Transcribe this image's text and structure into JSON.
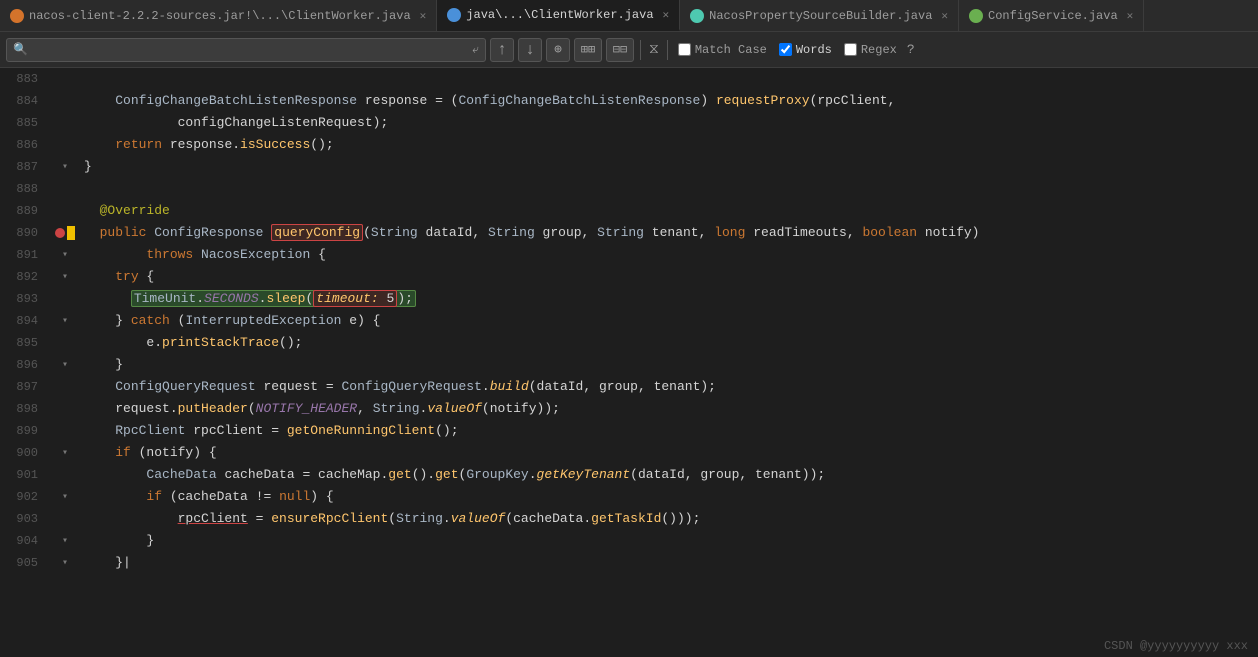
{
  "tabs": [
    {
      "id": "tab1",
      "icon": "orange",
      "label": "nacos-client-2.2.2-sources.jar!\\...\\ClientWorker.java",
      "active": false
    },
    {
      "id": "tab2",
      "icon": "blue",
      "label": "java\\...\\ClientWorker.java",
      "active": true
    },
    {
      "id": "tab3",
      "icon": "teal",
      "label": "NacosPropertySourceBuilder.java",
      "active": false
    },
    {
      "id": "tab4",
      "icon": "green",
      "label": "ConfigService.java",
      "active": false
    }
  ],
  "search": {
    "placeholder": "",
    "value": "",
    "match_case_label": "Match Case",
    "words_label": "Words",
    "regex_label": "Regex",
    "words_checked": true,
    "help_label": "?"
  },
  "lines": [
    {
      "num": 883,
      "icons": "",
      "code_html": ""
    },
    {
      "num": 884,
      "icons": "",
      "code_html": "    <span class='type'>ConfigChangeBatchListenResponse</span> response = (<span class='type'>ConfigChangeBatchListenResponse</span>) <span class='method'>requestProxy</span>(rpcClient,"
    },
    {
      "num": 885,
      "icons": "",
      "code_html": "            configChangeListenRequest);"
    },
    {
      "num": 886,
      "icons": "",
      "code_html": "    <span class='kw'>return</span> response.<span class='method'>isSuccess</span>();"
    },
    {
      "num": 887,
      "icons": "fold",
      "code_html": "}"
    },
    {
      "num": 888,
      "icons": "",
      "code_html": ""
    },
    {
      "num": 889,
      "icons": "",
      "code_html": "  <span class='annotation'>@Override</span>"
    },
    {
      "num": 890,
      "icons": "bp+debug",
      "code_html": "  <span class='kw'>public</span> <span class='type'>ConfigResponse</span> <span class='highlight-box'><span class='method'>queryConfig</span></span>(<span class='type'>String</span> dataId, <span class='type'>String</span> group, <span class='type'>String</span> tenant, <span class='kw'>long</span> readTimeouts, <span class='kw'>boolean</span> notify)"
    },
    {
      "num": 891,
      "icons": "fold",
      "code_html": "        <span class='kw'>throws</span> <span class='type'>NacosException</span> {"
    },
    {
      "num": 892,
      "icons": "fold",
      "code_html": "    <span class='kw'>try</span> {"
    },
    {
      "num": 893,
      "icons": "",
      "code_html": "      <span class='highlight-box2'><span class='type'>TimeUnit</span>.<span class='constant italic-param'>SECONDS</span>.<span class='method'>sleep</span>(<span class='highlight-box'><span class='italic-param param'>timeout:</span> 5</span>);</span>"
    },
    {
      "num": 894,
      "icons": "fold",
      "code_html": "    } <span class='kw'>catch</span> (<span class='type'>InterruptedException</span> e) {"
    },
    {
      "num": 895,
      "icons": "",
      "code_html": "        e.<span class='method'>printStackTrace</span>();"
    },
    {
      "num": 896,
      "icons": "fold",
      "code_html": "    }"
    },
    {
      "num": 897,
      "icons": "",
      "code_html": "    <span class='type'>ConfigQueryRequest</span> request = <span class='type'>ConfigQueryRequest</span>.<span class='method italic-param'>build</span>(dataId, group, tenant);"
    },
    {
      "num": 898,
      "icons": "",
      "code_html": "    request.<span class='method'>putHeader</span>(<span class='constant italic-param'>NOTIFY_HEADER</span>, <span class='type'>String</span>.<span class='method italic-param'>valueOf</span>(notify));"
    },
    {
      "num": 899,
      "icons": "",
      "code_html": "    <span class='type'>RpcClient</span> rpcClient = <span class='method'>getOneRunningClient</span>();"
    },
    {
      "num": 900,
      "icons": "fold",
      "code_html": "    <span class='kw'>if</span> (notify) {"
    },
    {
      "num": 901,
      "icons": "",
      "code_html": "        <span class='type'>CacheData</span> cacheData = cacheMap.<span class='method'>get</span>().<span class='method'>get</span>(<span class='type'>GroupKey</span>.<span class='method italic-param'>getKeyTenant</span>(dataId, group, tenant));"
    },
    {
      "num": 902,
      "icons": "fold",
      "code_html": "        <span class='kw'>if</span> (cacheData != <span class='kw'>null</span>) {"
    },
    {
      "num": 903,
      "icons": "",
      "code_html": "            <span class='underline-red'>rpcClient</span> = <span class='method'>ensureRpcClient</span>(<span class='type'>String</span>.<span class='method italic-param'>valueOf</span>(cacheData.<span class='method'>getTaskId</span>()));"
    },
    {
      "num": 904,
      "icons": "fold",
      "code_html": "        }"
    },
    {
      "num": 905,
      "icons": "fold",
      "code_html": "    }|"
    }
  ],
  "watermark": "CSDN @yyyyyyyyyy xxx"
}
